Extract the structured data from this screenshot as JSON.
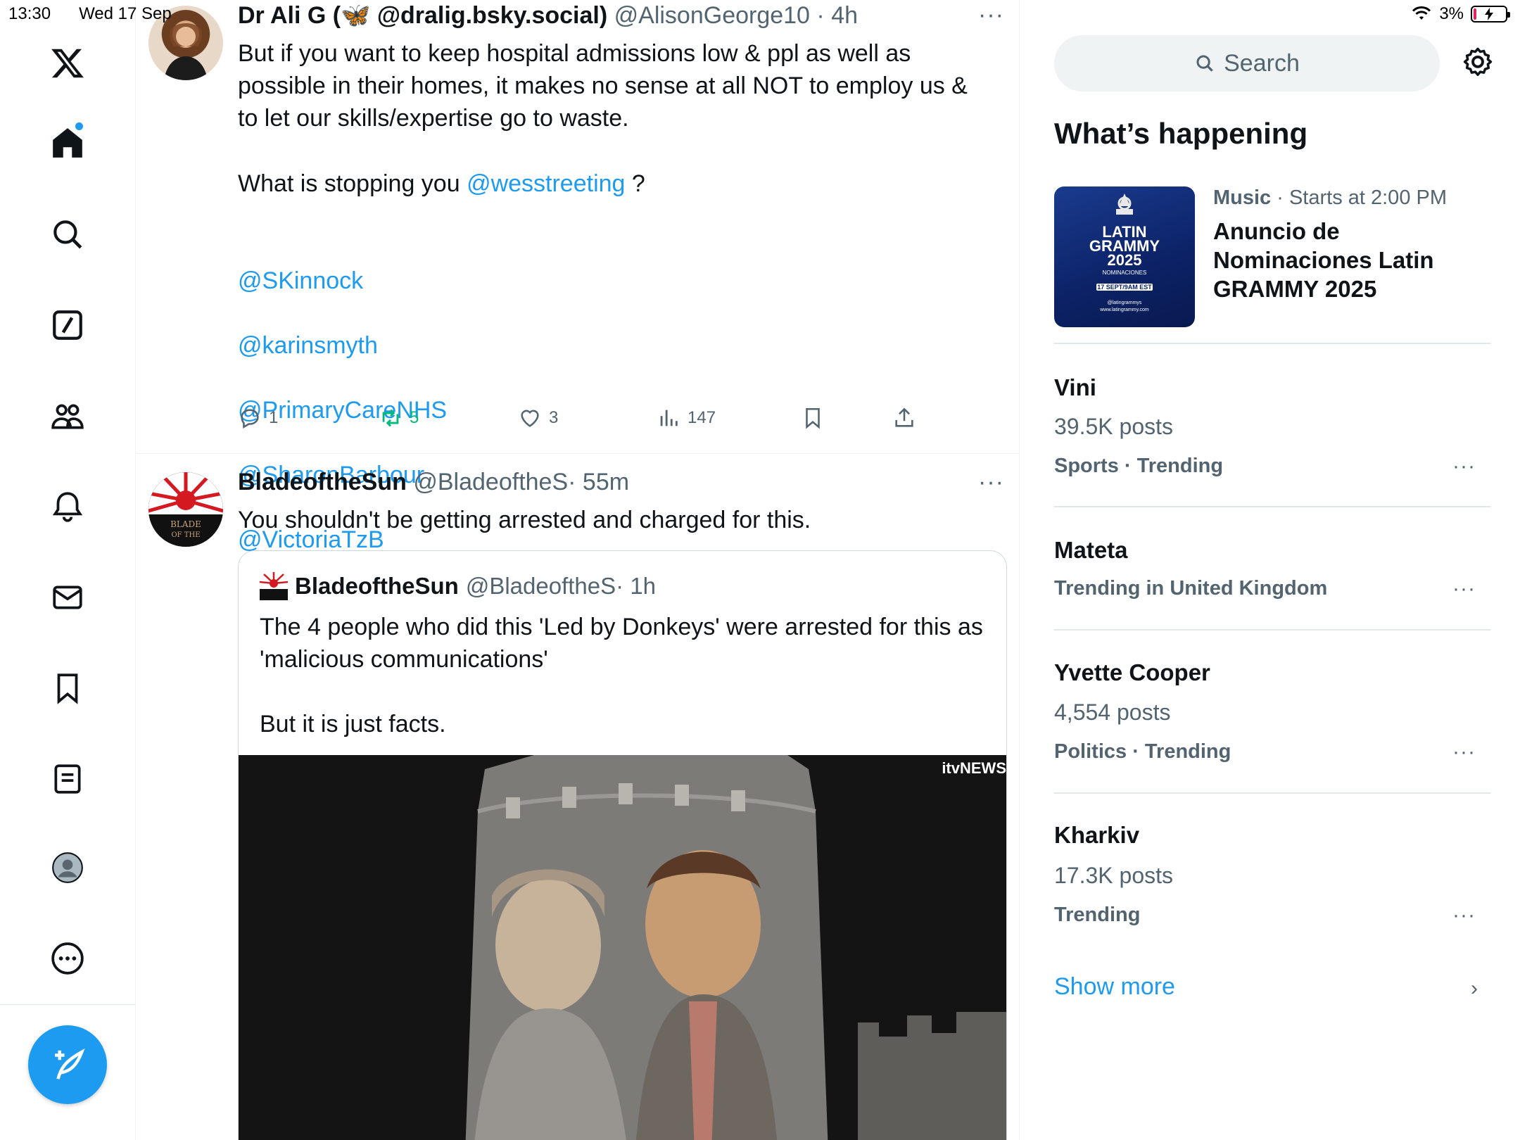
{
  "status": {
    "time": "13:30",
    "date": "Wed 17 Sep",
    "battery": "3%"
  },
  "colors": {
    "accent": "#1d9bf0",
    "text_secondary": "#536471",
    "repost_active": "#00ba7c"
  },
  "nav": {
    "items": [
      {
        "name": "x-logo-icon"
      },
      {
        "name": "home-icon"
      },
      {
        "name": "search-icon"
      },
      {
        "name": "grok-icon"
      },
      {
        "name": "communities-icon"
      },
      {
        "name": "notifications-icon"
      },
      {
        "name": "messages-icon"
      },
      {
        "name": "bookmarks-icon"
      },
      {
        "name": "lists-icon"
      },
      {
        "name": "profile-icon"
      },
      {
        "name": "more-icon"
      }
    ],
    "compose": "compose-post-icon"
  },
  "tweet1": {
    "name": "Dr Ali G (🦋 @dralig.bsky.social)",
    "handle": "@AlisonGeorge10",
    "time": "· 4h",
    "text": "But if you want to keep hospital admissions low & ppl as well as possible in their homes, it makes no sense at all NOT to employ us & to let our skills/expertise go to waste.",
    "text2_prefix": "What is stopping you ",
    "text2_link": "@wesstreeting",
    "text2_suffix": " ?",
    "mentions": [
      "@SKinnock",
      "@karinsmyth",
      "@PrimaryCareNHS",
      "@SharonBarbour",
      "@VictoriaTzB"
    ],
    "replies": "1",
    "reposts": "5",
    "likes": "3",
    "views": "147"
  },
  "tweet2": {
    "name": "BladeoftheSun",
    "handle": "@BladeoftheS",
    "time": "· 55m",
    "text": "You shouldn't be getting arrested and charged for this.",
    "avatar_text": "BLADE OF THE",
    "quote": {
      "name": "BladeoftheSun",
      "handle": "@BladeoftheS",
      "time": "· 1h",
      "text": "The 4 people who did this 'Led by Donkeys' were arrested for this as 'malicious communications'\n\nBut it is just facts.",
      "media_watermark": "itvNEWS"
    }
  },
  "sidebar": {
    "search_placeholder": "Search",
    "section_title": "What’s happening",
    "event": {
      "category": "Music",
      "meta": " · Starts at 2:00 PM",
      "title": "Anuncio de Nominaciones Latin GRAMMY 2025",
      "image_text": {
        "line1": "LATIN",
        "line2": "GRAMMY",
        "line3": "2025",
        "line4": "NOMINACIONES",
        "line5": "17 SEPT/9AM EST",
        "line6": "@latingrammys",
        "line7": "www.latingrammy.com"
      }
    },
    "trends": [
      {
        "title": "Vini",
        "posts": "39.5K posts",
        "context": "Sports · Trending"
      },
      {
        "title": "Mateta",
        "posts": "",
        "context": "Trending in United Kingdom"
      },
      {
        "title": "Yvette Cooper",
        "posts": "4,554 posts",
        "context": "Politics · Trending"
      },
      {
        "title": "Kharkiv",
        "posts": "17.3K posts",
        "context": "Trending"
      }
    ],
    "show_more": "Show more"
  }
}
